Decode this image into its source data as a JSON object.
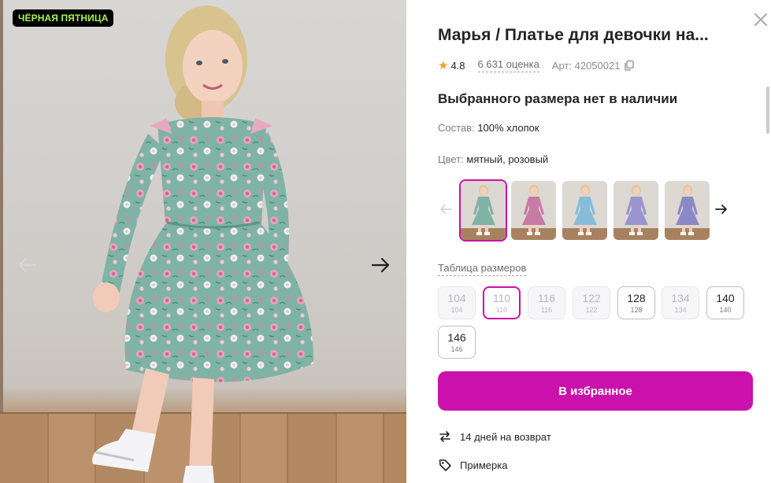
{
  "gallery": {
    "badge": "ЧЁРНАЯ ПЯТНИЦА",
    "prev_icon": "arrow-left-icon",
    "next_icon": "arrow-right-icon"
  },
  "product": {
    "title": "Марья / Платье для девочки на...",
    "rating": "4.8",
    "reviews": "6 631 оценка",
    "article": "Арт: 42050021",
    "availability": "Выбранного размера нет в наличии",
    "composition_label": "Состав:",
    "composition_value": "100% хлопок",
    "color_label": "Цвет:",
    "color_value": "мятный, розовый"
  },
  "colors": [
    {
      "name": "mint",
      "dress": "#7fb3a6"
    },
    {
      "name": "pink",
      "dress": "#c87aa6"
    },
    {
      "name": "light-blue",
      "dress": "#86bcd8"
    },
    {
      "name": "lilac",
      "dress": "#9a95cf"
    },
    {
      "name": "lavender",
      "dress": "#8a89c6"
    }
  ],
  "size_table_label": "Таблица размеров",
  "sizes": [
    {
      "label": "104",
      "sub": "104",
      "state": "unavailable"
    },
    {
      "label": "110",
      "sub": "110",
      "state": "selected-unavailable"
    },
    {
      "label": "116",
      "sub": "116",
      "state": "unavailable"
    },
    {
      "label": "122",
      "sub": "122",
      "state": "unavailable"
    },
    {
      "label": "128",
      "sub": "128",
      "state": "available"
    },
    {
      "label": "134",
      "sub": "134",
      "state": "unavailable"
    },
    {
      "label": "140",
      "sub": "140",
      "state": "available"
    },
    {
      "label": "146",
      "sub": "146",
      "state": "available"
    }
  ],
  "actions": {
    "favorite_label": "В избранное"
  },
  "features": [
    {
      "icon": "return-arrows-icon",
      "label": "14 дней на возврат"
    },
    {
      "icon": "tag-icon",
      "label": "Примерка"
    }
  ],
  "theme": {
    "accent": "#cb11ab",
    "badge_text": "#a6f34e",
    "star": "#f4a02a"
  }
}
